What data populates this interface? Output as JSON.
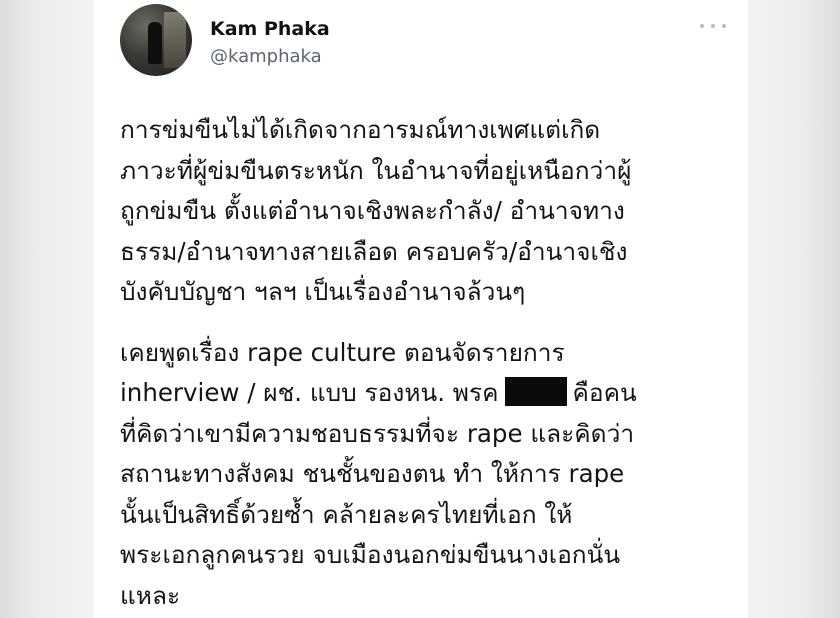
{
  "user": {
    "name": "Kam Phaka",
    "handle": "@kamphaka"
  },
  "more_icon": "more-horizontal-icon",
  "tweet": {
    "paragraph1": [
      "การข่มขืนไม่ได้เกิดจากอารมณ์ทางเพศแต่เกิด",
      "ภาวะที่ผู้ข่มขืนตระหนัก ในอำนาจที่อยู่เหนือกว่าผู้",
      "ถูกข่มขืน ตั้งแต่อำนาจเชิงพละกำลัง/ อำนาจทาง",
      "ธรรม/อำนาจทางสายเลือด ครอบครัว/อำนาจเชิง",
      "บังคับบัญชา ฯลฯ เป็นเรื่องอำนาจล้วนๆ"
    ],
    "paragraph2": {
      "line1": "เคยพูดเรื่อง rape culture ตอนจัดรายการ",
      "line2_before": "inherview / ผช. แบบ รองหน. พรค",
      "line2_after": "คือคน",
      "line3": "ที่คิดว่าเขามีความชอบธรรมที่จะ rape และคิดว่า",
      "line4": "สถานะทางสังคม ชนชั้นของตน ทำ ให้การ rape",
      "line5": "นั้นเป็นสิทธิ์ด้วยซ้ำ คล้ายละครไทยที่เอก ให้",
      "line6": "พระเอกลูกคนรวย จบเมืองนอกข่มขืนนางเอกนั่น",
      "line7": "แหละ"
    }
  }
}
